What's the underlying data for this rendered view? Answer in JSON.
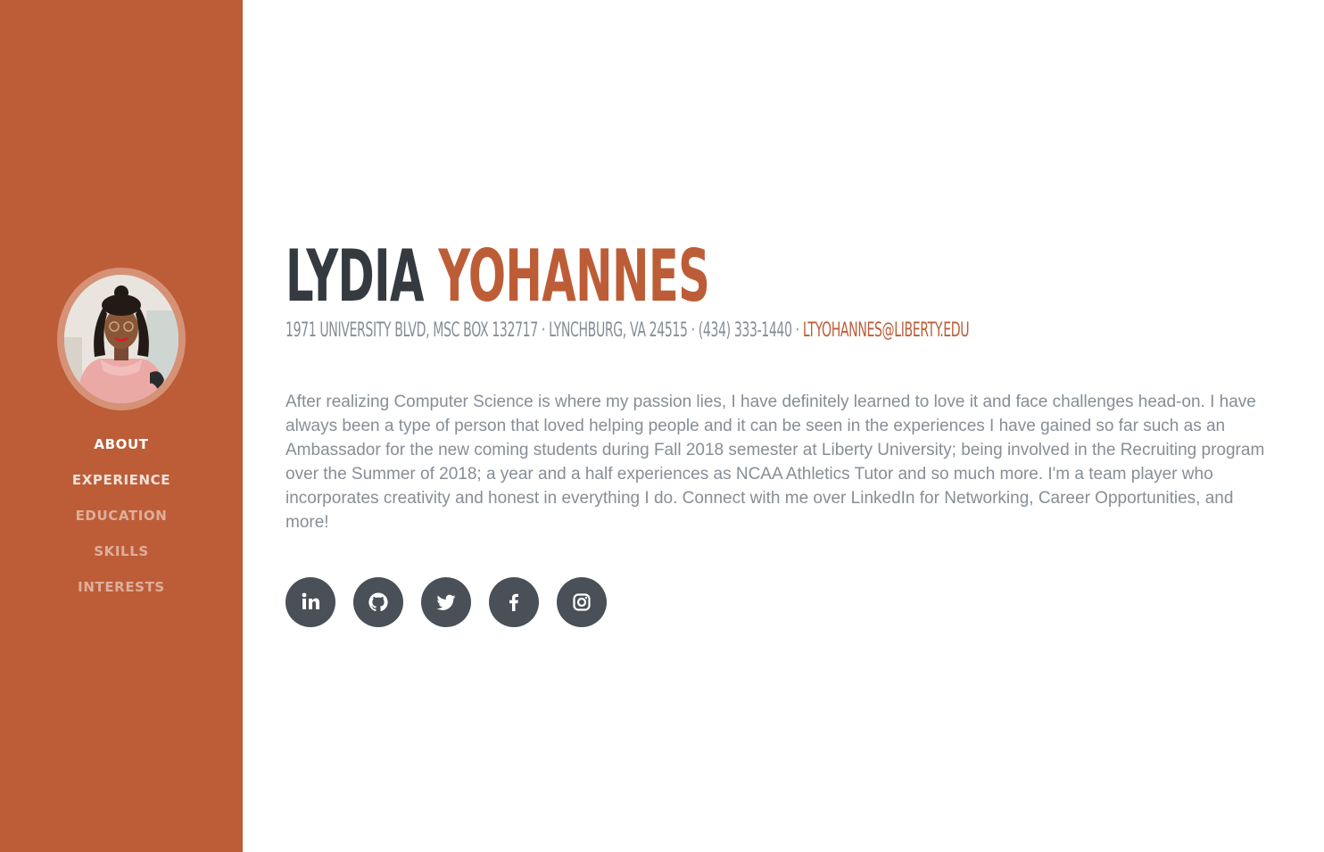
{
  "colors": {
    "sidebar": "#bd5d38",
    "accent": "#bd5d38",
    "heading": "#343a40",
    "muted": "#868e96",
    "social_bg": "#495057"
  },
  "profile_image": {
    "alt": "profile photo"
  },
  "nav": {
    "items": [
      {
        "label": "About",
        "state": "active"
      },
      {
        "label": "Experience",
        "state": "hover"
      },
      {
        "label": "Education",
        "state": "normal"
      },
      {
        "label": "Skills",
        "state": "normal"
      },
      {
        "label": "Interests",
        "state": "normal"
      }
    ]
  },
  "about": {
    "first_name": "LYDIA",
    "last_name": "YOHANNES",
    "address": "1971 University Blvd, MSC Box 132717 · Lynchburg, VA 24515 · (434) 333-1440 · ",
    "email": "ltyohannes@liberty.edu",
    "lead": "After realizing Computer Science is where my passion lies, I have definitely learned to love it and face challenges head-on. I have always been a type of person that loved helping people and it can be seen in the experiences I have gained so far such as an Ambassador for the new coming students during Fall 2018 semester at Liberty University; being involved in the Recruiting program over the Summer of 2018; a year and a half experiences as NCAA Athletics Tutor and so much more. I'm a team player who incorporates creativity and honest in everything I do. Connect with me over LinkedIn for Networking, Career Opportunities, and more!"
  },
  "social": [
    {
      "name": "linkedin",
      "icon": "linkedin-icon"
    },
    {
      "name": "github",
      "icon": "github-icon"
    },
    {
      "name": "twitter",
      "icon": "twitter-icon"
    },
    {
      "name": "facebook",
      "icon": "facebook-icon"
    },
    {
      "name": "instagram",
      "icon": "instagram-icon"
    }
  ]
}
